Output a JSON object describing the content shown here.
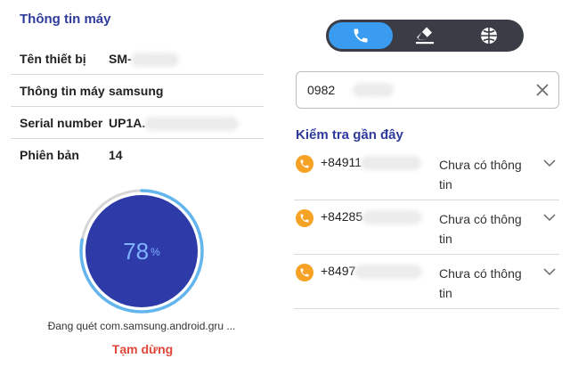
{
  "device_info": {
    "title": "Thông tin máy",
    "rows": [
      {
        "label": "Tên thiết bị",
        "value": "SM-"
      },
      {
        "label": "Thông tin máy",
        "value": "samsung"
      },
      {
        "label": "Serial number",
        "value": "UP1A."
      },
      {
        "label": "Phiên bản",
        "value": "14"
      }
    ]
  },
  "scan": {
    "progress": 78,
    "progress_value": "78",
    "percent_sign": "%",
    "status_text": "Đang quét com.samsung.android.gru ...",
    "pause_label": "Tạm dừng"
  },
  "modes": {
    "active": "phone",
    "items": [
      {
        "id": "phone",
        "icon": "phone-icon"
      },
      {
        "id": "sms",
        "icon": "eraser-icon"
      },
      {
        "id": "web",
        "icon": "globe-icon"
      }
    ]
  },
  "search": {
    "value": "0982"
  },
  "recent": {
    "title": "Kiểm tra gần đây",
    "items": [
      {
        "number": "+84911",
        "status": "Chưa có thông tin"
      },
      {
        "number": "+84285",
        "status": "Chưa có thông tin"
      },
      {
        "number": "+8497",
        "status": "Chưa có thông tin"
      }
    ]
  },
  "colors": {
    "accent": "#2f3b9b",
    "gauge_fill": "#2d3aa8",
    "gauge_ring": "#63b5ee",
    "active_mode": "#3a9cf0",
    "pause": "#e0473a",
    "call_badge": "#f6a224"
  }
}
